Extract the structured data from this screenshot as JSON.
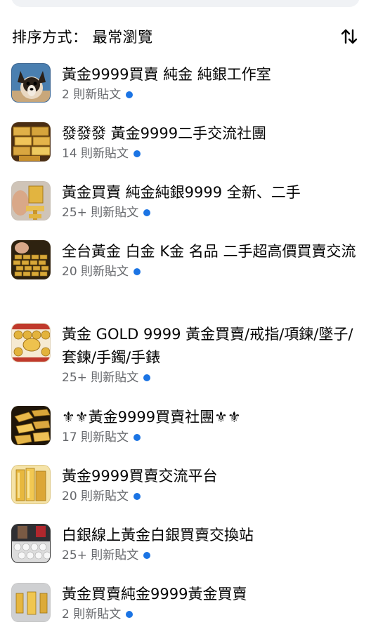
{
  "sort": {
    "label": "排序方式： 最常瀏覽"
  },
  "colors": {
    "accent_dot": "#1b74e4",
    "secondary_text": "#65676b"
  },
  "groups": [
    {
      "title": "黃金9999買賣 純金 純銀工作室",
      "posts": "2 則新貼文",
      "thumb": "dog-photo"
    },
    {
      "title": "發發發 黃金9999二手交流社團",
      "posts": "14 則新貼文",
      "thumb": "gold-bars-stack"
    },
    {
      "title": "黃金買賣 純金純銀9999 全新、二手",
      "posts": "25+ 則新貼文",
      "thumb": "gold-horse-hand"
    },
    {
      "title": "全台黃金 白金  K金  名品 二手超高價買賣交流",
      "posts": "20 則新貼文",
      "thumb": "gold-ingots-hand"
    },
    {
      "title": "黃金 GOLD 9999 黃金買賣/戒指/項鍊/墜子/套鍊/手鐲/手錶",
      "posts": "25+ 則新貼文",
      "thumb": "gold-coins-tray"
    },
    {
      "title": "⚜⚜黃金9999買賣社團⚜⚜",
      "posts": "17 則新貼文",
      "thumb": "gold-bars-pile"
    },
    {
      "title": "黃金9999買賣交流平台",
      "posts": "20 則新貼文",
      "thumb": "gold-bars-bright"
    },
    {
      "title": "白銀線上黃金白銀買賣交換站",
      "posts": "25+ 則新貼文",
      "thumb": "silver-shop"
    },
    {
      "title": "黃金買賣純金9999黃金買賣",
      "posts": "2 則新貼文",
      "thumb": "gold-bars-small"
    }
  ]
}
